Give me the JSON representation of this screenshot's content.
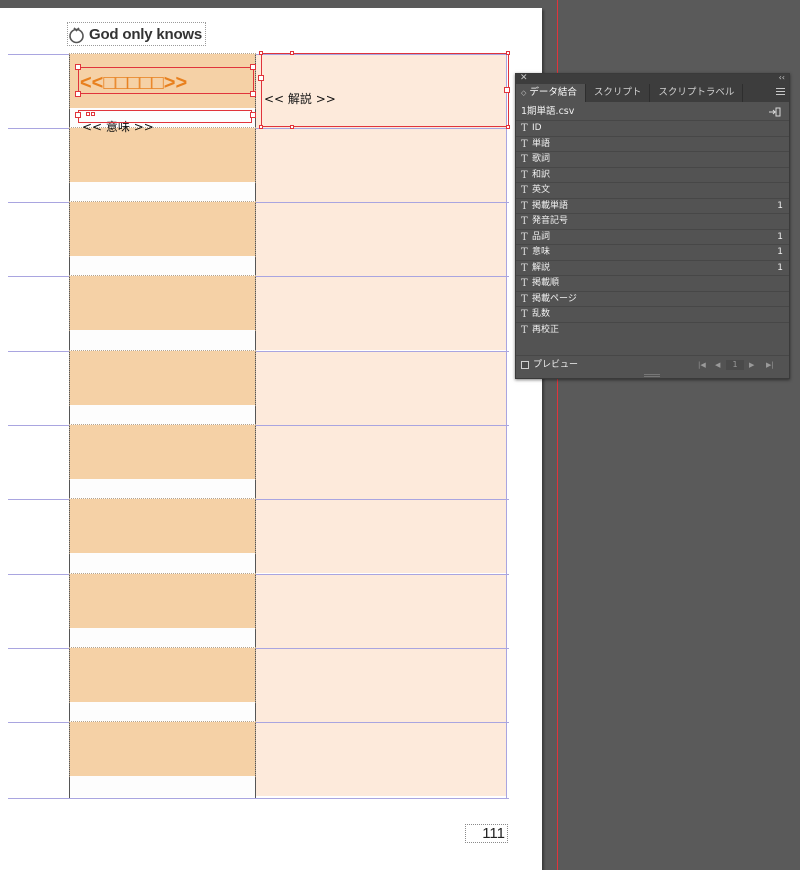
{
  "app": {
    "page_header": "God only knows",
    "page_number": "111"
  },
  "layout_fields": {
    "term_placeholder": "<<□□□□□>>",
    "meaning_placeholder": "<< 意味 >>",
    "description_placeholder": "<< 解説 >>"
  },
  "colors": {
    "term_fill": "#f5d1a6",
    "description_fill": "#fdeadb",
    "term_text": "#e8801e",
    "selection": "#e0343b",
    "guide": "#a9a5e0"
  },
  "panel": {
    "tabs": [
      {
        "label": "データ結合",
        "active": true
      },
      {
        "label": "スクリプト",
        "active": false
      },
      {
        "label": "スクリプトラベル",
        "active": false
      }
    ],
    "data_source": "1期単語.csv",
    "fields": [
      {
        "icon": "T",
        "name": "ID",
        "count": ""
      },
      {
        "icon": "T",
        "name": "単語",
        "count": ""
      },
      {
        "icon": "T",
        "name": "歌詞",
        "count": ""
      },
      {
        "icon": "T",
        "name": "和訳",
        "count": ""
      },
      {
        "icon": "T",
        "name": "英文",
        "count": ""
      },
      {
        "icon": "T",
        "name": "掲載単語",
        "count": "1"
      },
      {
        "icon": "T",
        "name": "発音記号",
        "count": ""
      },
      {
        "icon": "T",
        "name": "品詞",
        "count": "1"
      },
      {
        "icon": "T",
        "name": "意味",
        "count": "1"
      },
      {
        "icon": "T",
        "name": "解説",
        "count": "1"
      },
      {
        "icon": "T",
        "name": "掲載順",
        "count": ""
      },
      {
        "icon": "T",
        "name": "掲載ページ",
        "count": ""
      },
      {
        "icon": "T",
        "name": "乱数",
        "count": ""
      },
      {
        "icon": "T",
        "name": "再校正",
        "count": ""
      }
    ],
    "preview_label": "プレビュー",
    "record_value": "1"
  }
}
